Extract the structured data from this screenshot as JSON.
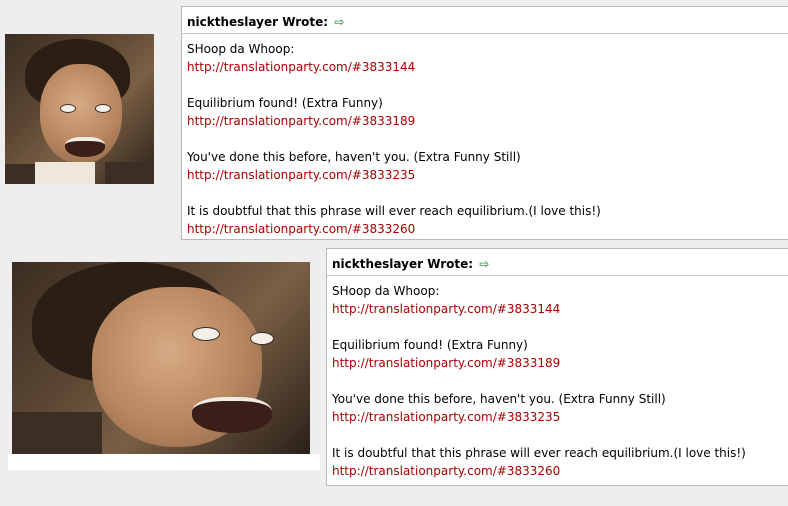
{
  "posts": [
    {
      "author_wrote": "nicktheslayer Wrote:",
      "lines": [
        {
          "text": "SHoop da Whoop:",
          "link": "http://translationparty.com/#3833144"
        },
        {
          "text": "Equilibrium found! (Extra Funny)",
          "link": "http://translationparty.com/#3833189"
        },
        {
          "text": "You've done this before, haven't you. (Extra Funny Still)",
          "link": "http://translationparty.com/#3833235"
        },
        {
          "text": "It is doubtful that this phrase will ever reach equilibrium.(I love this!)",
          "link": "http://translationparty.com/#3833260"
        }
      ]
    },
    {
      "author_wrote": "nicktheslayer Wrote:",
      "lines": [
        {
          "text": "SHoop da Whoop:",
          "link": "http://translationparty.com/#3833144"
        },
        {
          "text": "Equilibrium found! (Extra Funny)",
          "link": "http://translationparty.com/#3833189"
        },
        {
          "text": "You've done this before, haven't you. (Extra Funny Still)",
          "link": "http://translationparty.com/#3833235"
        },
        {
          "text": "It is doubtful that this phrase will ever reach equilibrium.(I love this!)",
          "link": "http://translationparty.com/#3833260"
        }
      ]
    }
  ],
  "icons": {
    "arrow": "right-arrow-icon"
  },
  "colors": {
    "link": "#aa0000",
    "arrow": "#3aa047",
    "background": "#eeeeee"
  }
}
